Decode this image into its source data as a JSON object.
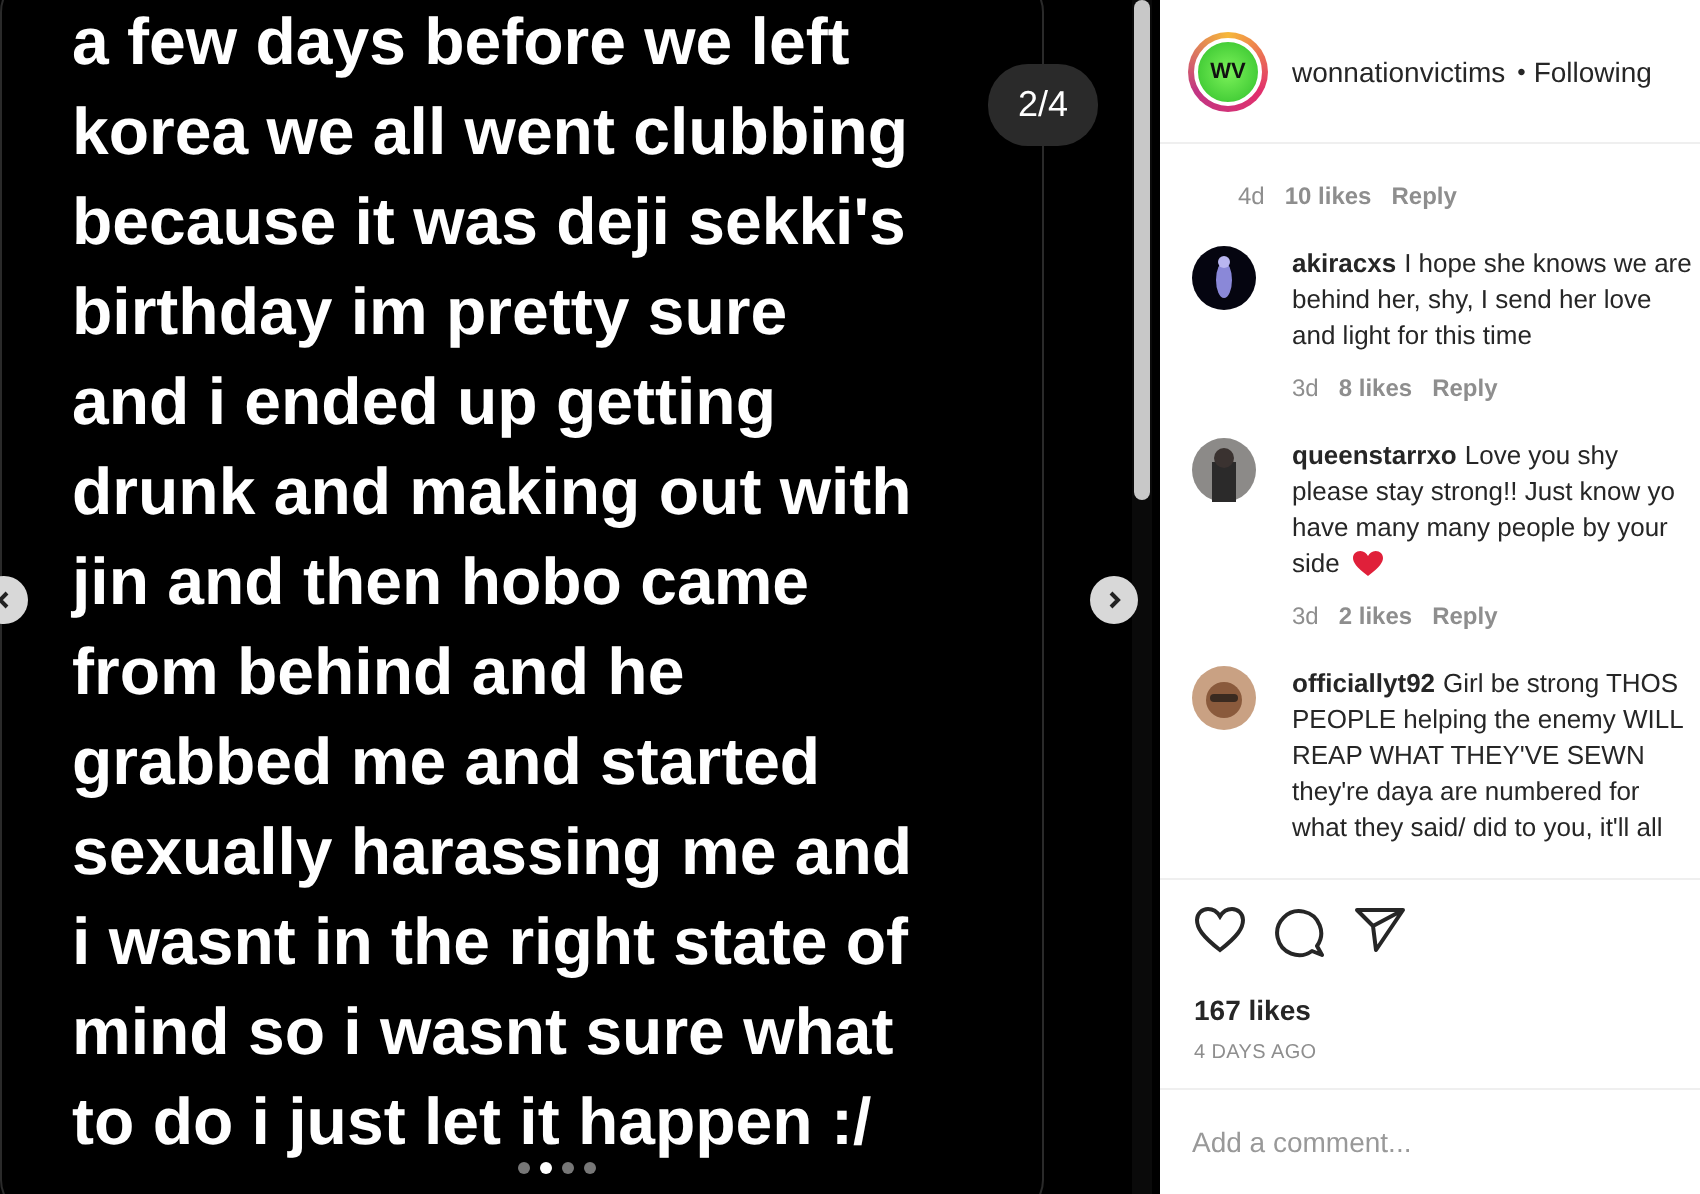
{
  "post": {
    "slide_lines": [
      "a few days before we left",
      "korea we all went clubbing",
      "because it was deji sekki's",
      "birthday im pretty sure",
      "and i ended up getting",
      "drunk and making out with",
      "jin and then hobo came",
      "from behind and he",
      "grabbed me and started",
      "sexually harassing me and",
      "i wasnt in the right state of",
      "mind so i wasnt sure what",
      "to do i just let it happen :/"
    ],
    "counter": "2/4",
    "dots": [
      {
        "selected": false
      },
      {
        "selected": true
      },
      {
        "selected": false
      },
      {
        "selected": false
      }
    ]
  },
  "header": {
    "avatar_text": "WV",
    "username": "wonnationvictims",
    "separator": "•",
    "follow_status": "Following"
  },
  "partial_meta": {
    "time": "4d",
    "likes": "10 likes",
    "reply": "Reply"
  },
  "comments": [
    {
      "username": "akiracxs",
      "lines": [
        "I hope she knows we are",
        "behind her, shy, I send her love",
        "and light for this time"
      ],
      "meta": {
        "time": "3d",
        "likes": "8 likes",
        "reply": "Reply"
      }
    },
    {
      "username": "queenstarrxo",
      "lines": [
        "Love you shy",
        "please stay strong!! Just know yo",
        "have many many people by your",
        "side"
      ],
      "heart": true,
      "meta": {
        "time": "3d",
        "likes": "2 likes",
        "reply": "Reply"
      }
    },
    {
      "username": "officiallyt92",
      "lines": [
        "Girl be strong THOS",
        "PEOPLE helping the enemy WILL",
        "REAP WHAT THEY'VE SEWN",
        "they're daya are numbered for",
        "what they said/ did to you, it'll all"
      ]
    }
  ],
  "likes": "167 likes",
  "timestamp": "4 DAYS AGO",
  "comment_field": {
    "placeholder": "Add a comment..."
  }
}
